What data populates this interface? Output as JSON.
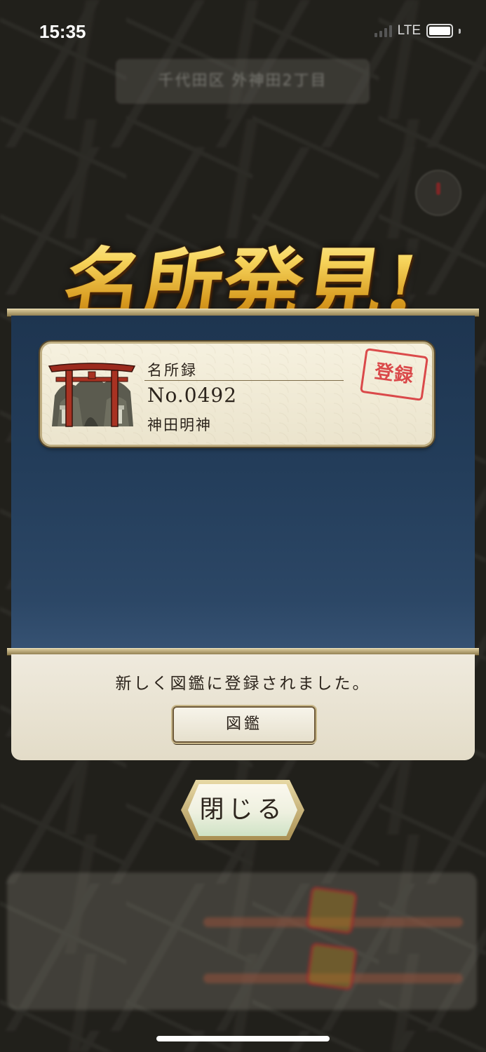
{
  "status_bar": {
    "time": "15:35",
    "network": "LTE"
  },
  "map": {
    "location_label": "千代田区 外神田2丁目"
  },
  "popup": {
    "title": "名所発見!",
    "card": {
      "heading": "名所録",
      "number": "No.0492",
      "name": "神田明神",
      "stamp": "登録",
      "art_icon": "torii-gate-icon"
    },
    "message": "新しく図鑑に登録されました。",
    "zukan_button": "図鑑",
    "close_button": "閉じる"
  },
  "colors": {
    "title_gold": "#f1c94a",
    "panel_blue": "#233d5a",
    "stamp_red": "#d8383b",
    "footer_cream": "#efeadd"
  }
}
